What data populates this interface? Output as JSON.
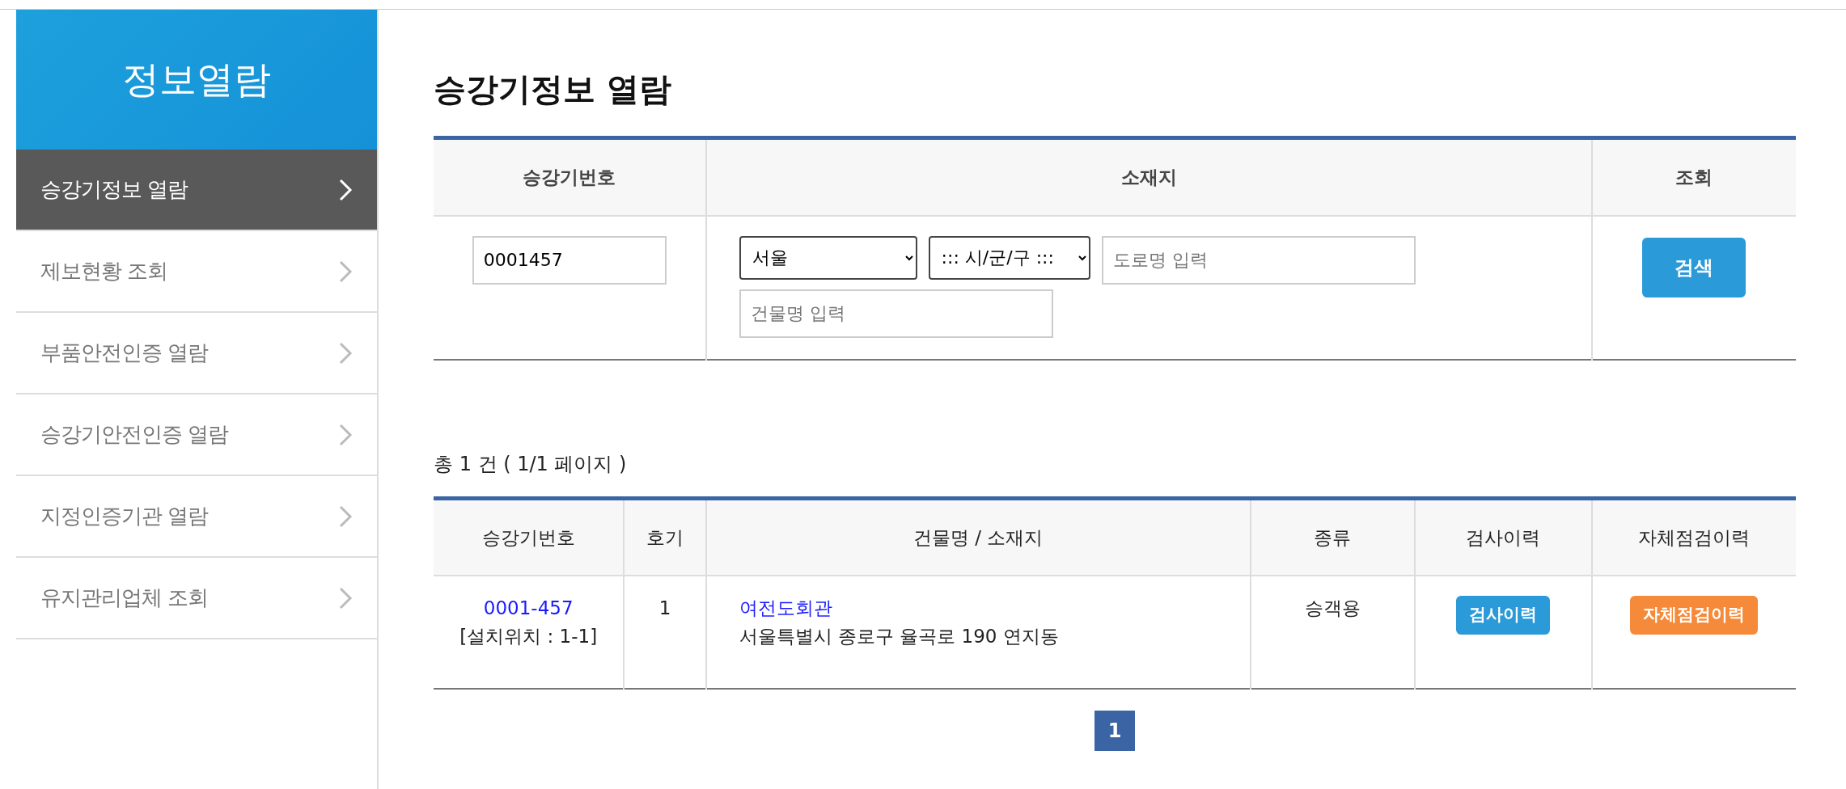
{
  "sidebar": {
    "title": "정보열람",
    "items": [
      {
        "label": "승강기정보 열람",
        "selected": true
      },
      {
        "label": "제보현황 조회",
        "selected": false
      },
      {
        "label": "부품안전인증 열람",
        "selected": false
      },
      {
        "label": "승강기안전인증 열람",
        "selected": false
      },
      {
        "label": "지정인증기관 열람",
        "selected": false
      },
      {
        "label": "유지관리업체 조회",
        "selected": false
      }
    ]
  },
  "page_title": "승강기정보 열람",
  "search": {
    "columns": [
      "승강기번호",
      "소재지",
      "조회"
    ],
    "number_value": "0001457",
    "region_value": "서울",
    "district_value": "::: 시/군/구 :::",
    "road_placeholder": "도로명 입력",
    "building_placeholder": "건물명 입력",
    "button": "검색"
  },
  "count_text": "총 1 건 ( 1/1 페이지 )",
  "table": {
    "columns": [
      "승강기번호",
      "호기",
      "건물명 / 소재지",
      "종류",
      "검사이력",
      "자체점검이력"
    ],
    "rows": [
      {
        "number": "0001-457",
        "location": "[설치위치 : 1-1]",
        "unit": "1",
        "building": "여전도회관",
        "address": "서울특별시 종로구 율곡로 190 연지동",
        "type": "승객용",
        "inspection": "검사이력",
        "self_check": "자체점검이력"
      }
    ]
  },
  "pagination": [
    {
      "label": "1",
      "selected": true
    }
  ]
}
